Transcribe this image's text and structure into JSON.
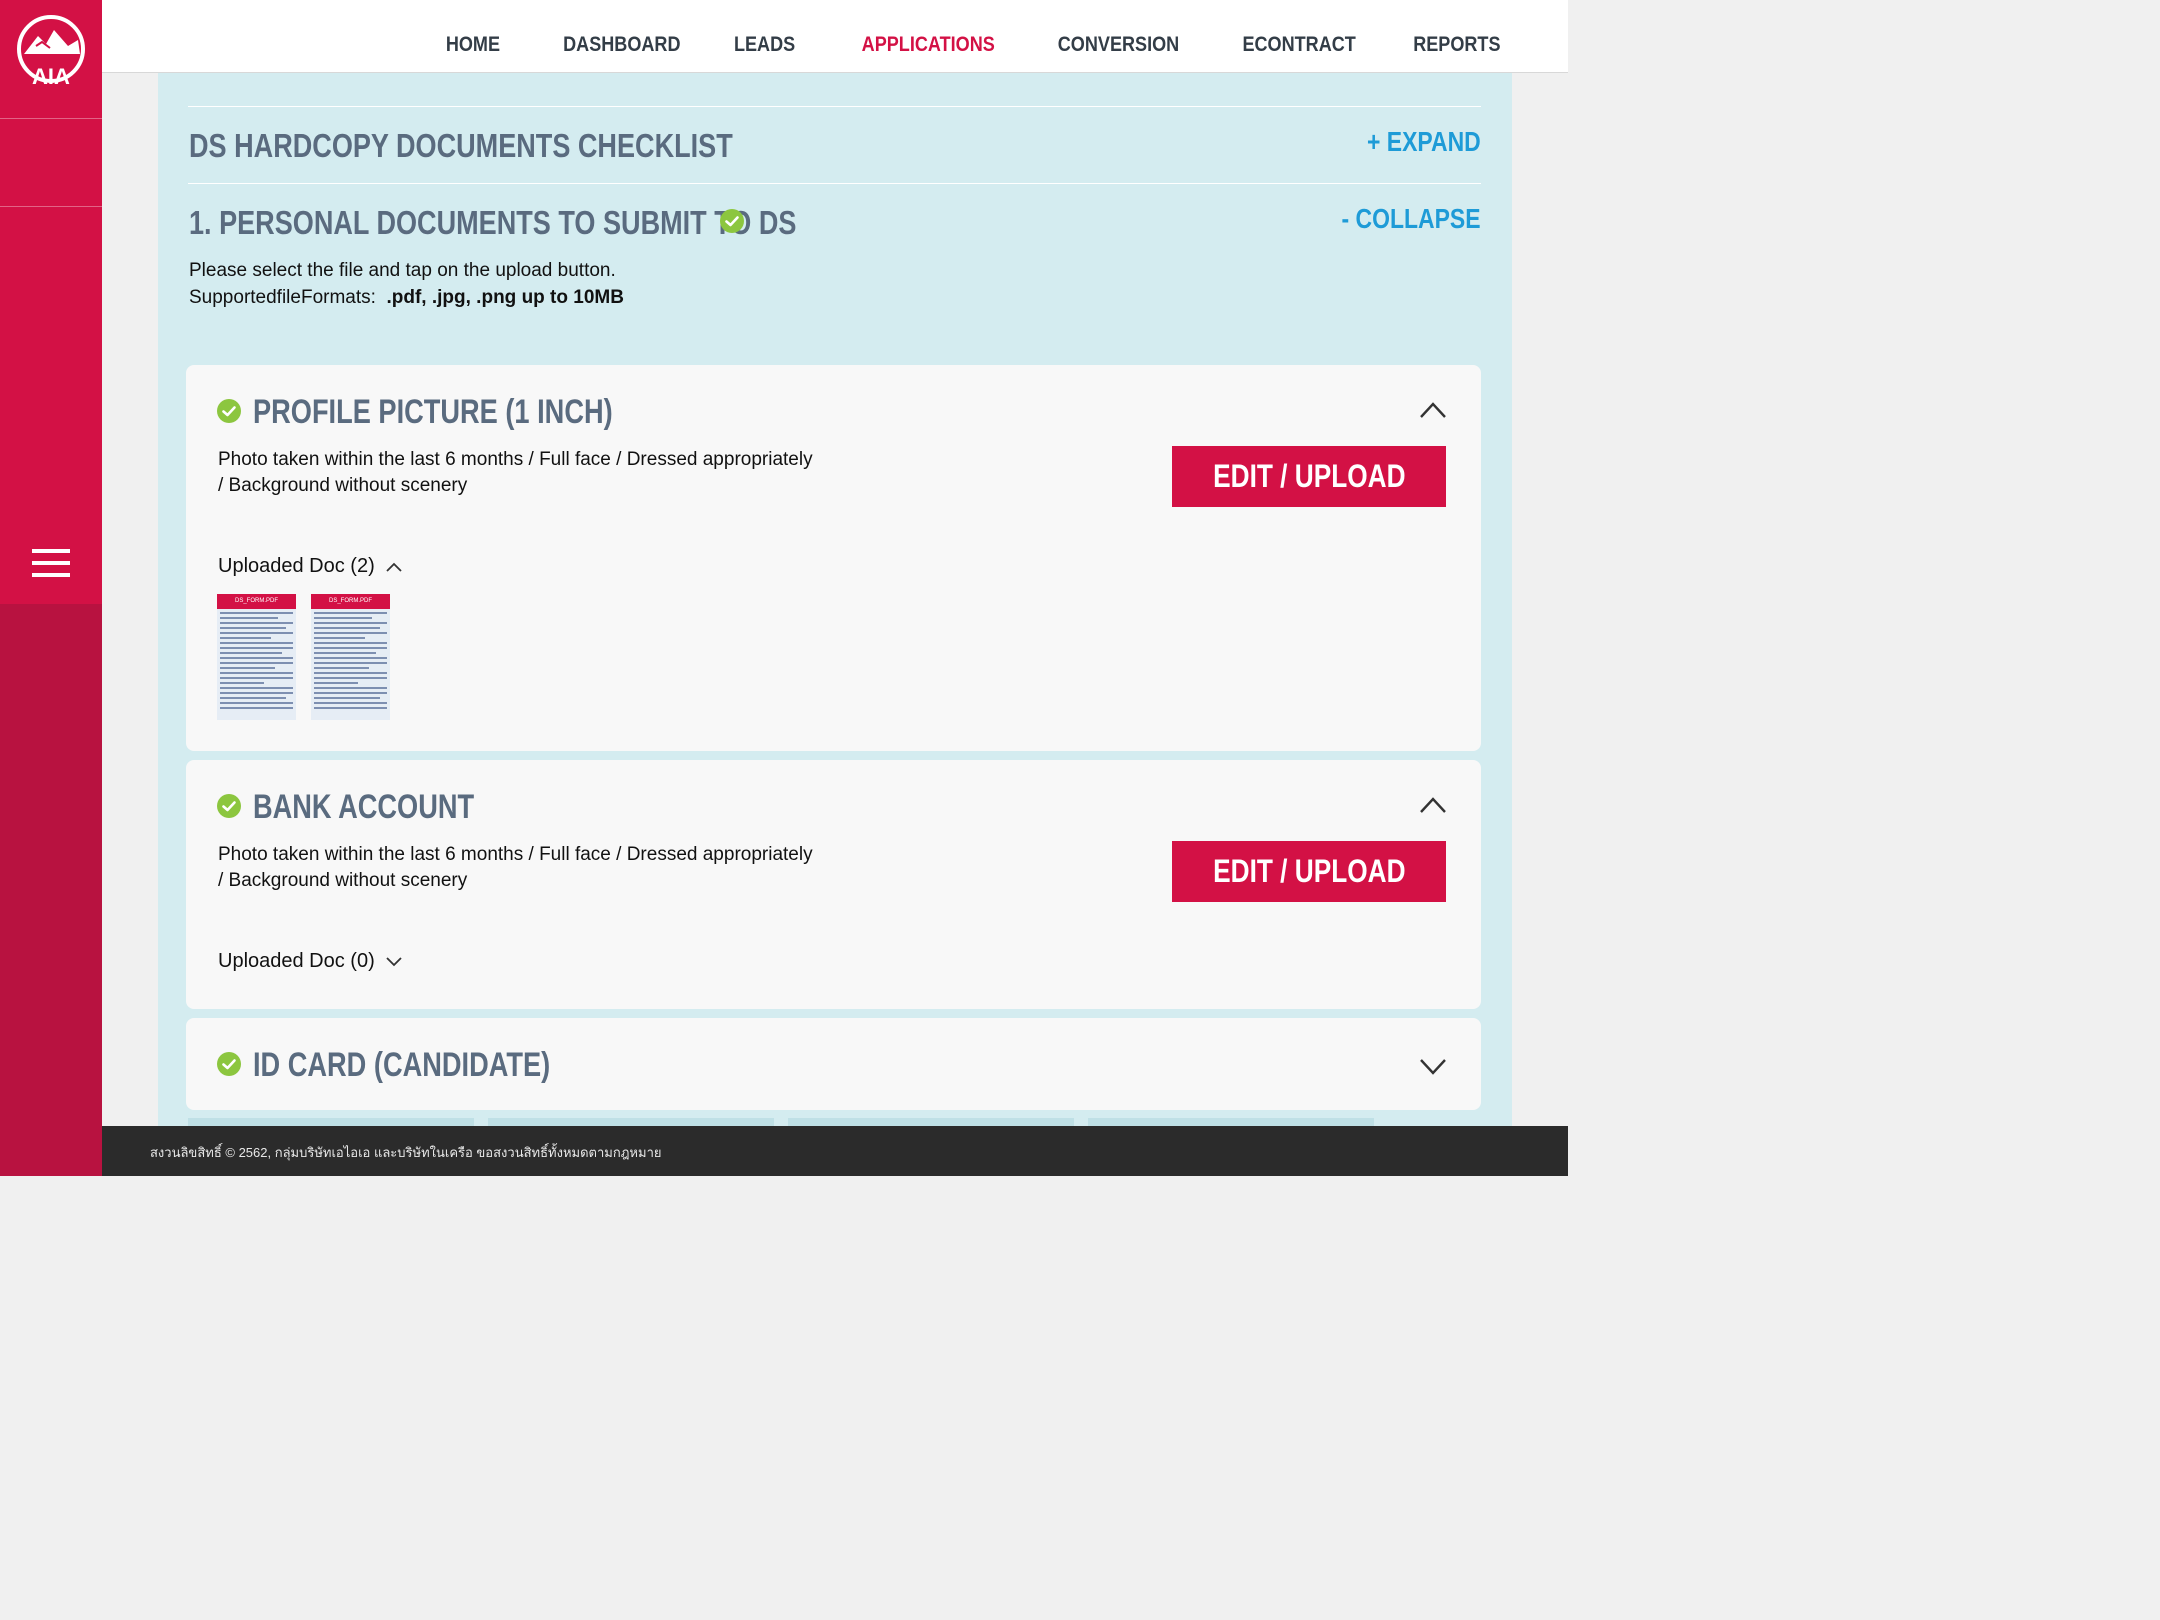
{
  "sidebar": {
    "logo_text": "AIA",
    "back_icon": "arrow-left-icon",
    "menu_icon": "hamburger-menu-icon"
  },
  "nav": {
    "items": [
      "HOME",
      "DASHBOARD",
      "LEADS",
      "APPLICATIONS",
      "CONVERSION",
      "ECONTRACT",
      "REPORTS"
    ],
    "active": "APPLICATIONS"
  },
  "checklist": {
    "title": "DS HARDCOPY DOCUMENTS CHECKLIST",
    "expand_label": "+ EXPAND"
  },
  "section": {
    "title": "1. PERSONAL DOCUMENTS TO SUBMIT TO DS",
    "collapse_label": "- COLLAPSE",
    "instruction": "Please select the file and tap on the upload button.",
    "formats_label": "SupportedfileFormats:",
    "formats_value": ".pdf, .jpg, .png up to 10MB"
  },
  "cards": [
    {
      "title": "PROFILE PICTURE (1 INCH)",
      "desc_line1": "Photo taken within the last 6 months / Full face / Dressed appropriately",
      "desc_line2": "/ Background without scenery",
      "button": "EDIT / UPLOAD",
      "uploaded": "Uploaded Doc (2)",
      "thumb_label": "DS_FORM.PDF"
    },
    {
      "title": "BANK ACCOUNT",
      "desc_line1": "Photo taken within the last 6 months / Full face / Dressed appropriately",
      "desc_line2": "/ Background without scenery",
      "button": "EDIT / UPLOAD",
      "uploaded": "Uploaded Doc (0)"
    },
    {
      "title": "ID CARD (CANDIDATE)"
    }
  ],
  "footer": {
    "text": "สงวนลิขสิทธิ์ © 2562, กลุ่มบริษัทเอไอเอ และบริษัทในเครือ ขอสงวนสิทธิ์ทั้งหมดตามกฎหมาย"
  },
  "colors": {
    "brand_red": "#d31145",
    "panel_blue": "#d4ecf0",
    "link_blue": "#1e9bd7",
    "check_green": "#8cc63f",
    "title_slate": "#5a6b7f"
  }
}
